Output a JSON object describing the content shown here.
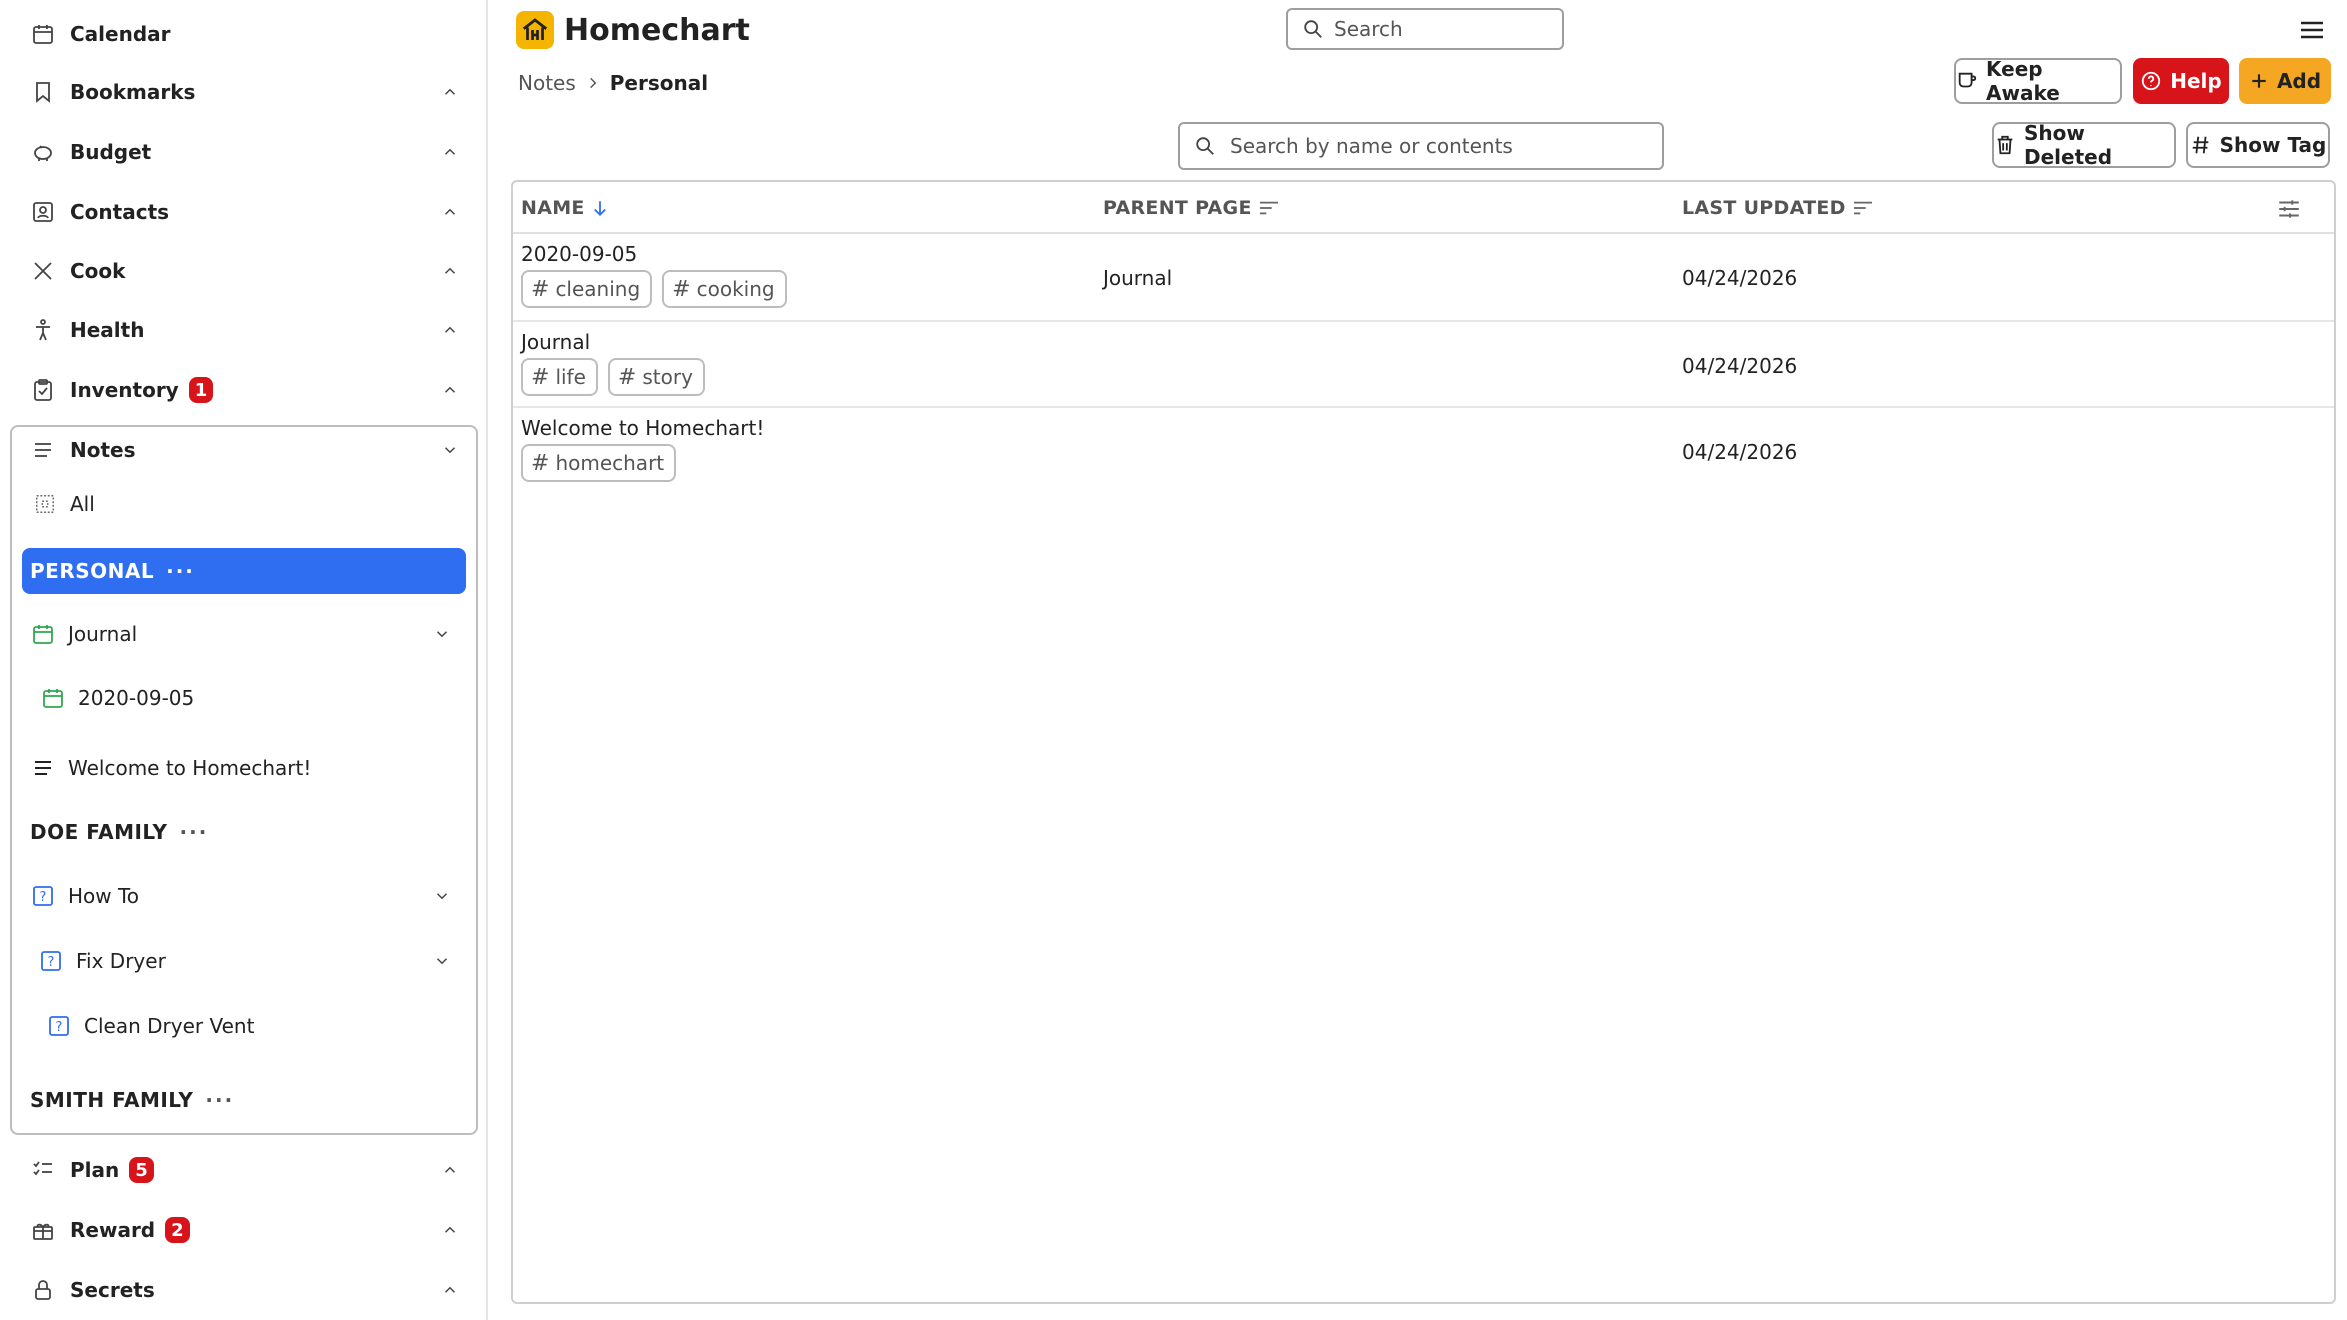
{
  "app": {
    "title": "Homechart",
    "search_placeholder": "Search"
  },
  "sidebar": {
    "calendar": "Calendar",
    "bookmarks": "Bookmarks",
    "budget": "Budget",
    "contacts": "Contacts",
    "cook": "Cook",
    "health": "Health",
    "inventory": "Inventory",
    "inventory_badge": "1",
    "notes": "Notes",
    "notes_all": "All",
    "personal": "PERSONAL",
    "journal": "Journal",
    "journal_child": "2020-09-05",
    "welcome": "Welcome to Homechart!",
    "doe_family": "DOE FAMILY",
    "how_to": "How To",
    "fix_dryer": "Fix Dryer",
    "clean_dryer_vent": "Clean Dryer Vent",
    "smith_family": "SMITH FAMILY",
    "plan": "Plan",
    "plan_badge": "5",
    "reward": "Reward",
    "reward_badge": "2",
    "secrets": "Secrets",
    "more_dots": "···"
  },
  "breadcrumb": {
    "parent": "Notes",
    "current": "Personal"
  },
  "toolbar": {
    "keep_awake": "Keep Awake",
    "help": "Help",
    "add": "Add",
    "filter_placeholder": "Search by name or contents",
    "show_deleted": "Show Deleted",
    "show_tag": "Show Tag"
  },
  "table": {
    "columns": {
      "name": "NAME",
      "parent_page": "PARENT PAGE",
      "last_updated": "LAST UPDATED"
    },
    "rows": [
      {
        "name": "2020-09-05",
        "tags": [
          "cleaning",
          "cooking"
        ],
        "parent": "Journal",
        "updated": "04/24/2026"
      },
      {
        "name": "Journal",
        "tags": [
          "life",
          "story"
        ],
        "parent": "",
        "updated": "04/24/2026"
      },
      {
        "name": "Welcome to Homechart!",
        "tags": [
          "homechart"
        ],
        "parent": "",
        "updated": "04/24/2026"
      }
    ]
  },
  "colors": {
    "accent_blue": "#2f6ef0",
    "help_red": "#d7141a",
    "add_orange": "#f5a623",
    "logo_yellow": "#f5b400",
    "calendar_green": "#2fa84f",
    "howto_blue": "#2f6ef0"
  }
}
